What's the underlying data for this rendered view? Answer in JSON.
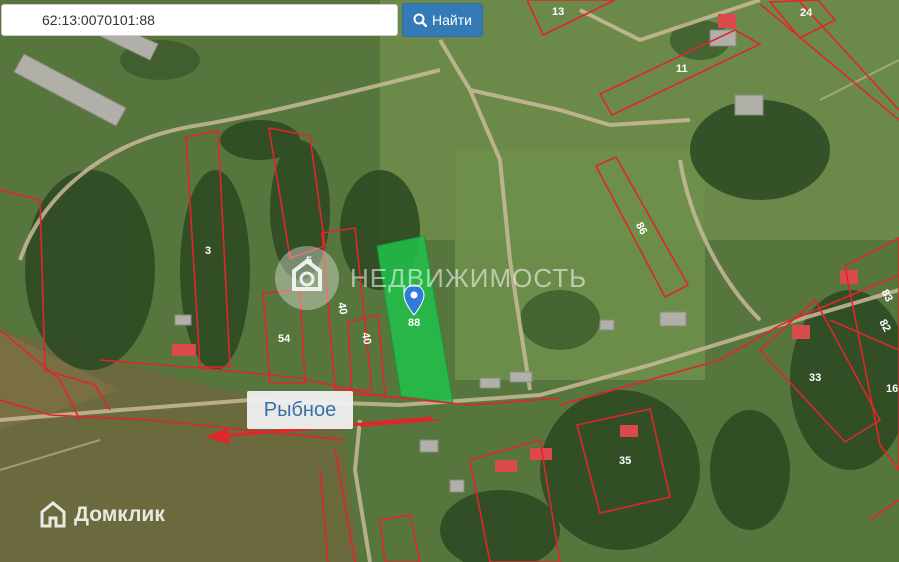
{
  "search": {
    "value": "62:13:0070101:88",
    "button_label": "Найти"
  },
  "map": {
    "place_label": "Рыбное",
    "watermark_text": "НЕДВИЖИМОСТЬ",
    "brand_text": "Домклик",
    "selected_plot": "88",
    "plot_labels": [
      "13",
      "24",
      "11",
      "86",
      "3",
      "5",
      "40",
      "40",
      "54",
      "83",
      "82",
      "16",
      "33",
      "35"
    ],
    "colors": {
      "boundary": "#e0262b",
      "selected_fill": "#21c24a",
      "pin": "#2f7bd8",
      "road": "#c9b99a"
    }
  }
}
